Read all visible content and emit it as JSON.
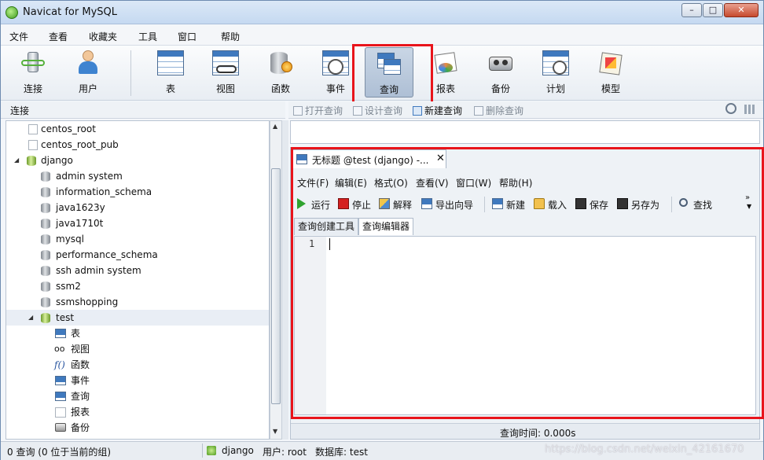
{
  "window": {
    "title": "Navicat for MySQL",
    "min": "–",
    "max": "□",
    "close": "✕"
  },
  "menu": [
    "文件",
    "查看",
    "收藏夹",
    "工具",
    "窗口",
    "帮助"
  ],
  "toolbar": [
    "连接",
    "用户",
    "表",
    "视图",
    "函数",
    "事件",
    "查询",
    "报表",
    "备份",
    "计划",
    "模型"
  ],
  "left": {
    "header": "连接",
    "tree": [
      {
        "label": "centos_root",
        "kind": "conn"
      },
      {
        "label": "centos_root_pub",
        "kind": "conn"
      },
      {
        "label": "django",
        "kind": "conn-open"
      },
      {
        "label": "admin system",
        "kind": "db"
      },
      {
        "label": "information_schema",
        "kind": "db"
      },
      {
        "label": "java1623y",
        "kind": "db"
      },
      {
        "label": "java1710t",
        "kind": "db"
      },
      {
        "label": "mysql",
        "kind": "db"
      },
      {
        "label": "performance_schema",
        "kind": "db"
      },
      {
        "label": "ssh admin system",
        "kind": "db"
      },
      {
        "label": "ssm2",
        "kind": "db"
      },
      {
        "label": "ssmshopping",
        "kind": "db"
      },
      {
        "label": "test",
        "kind": "db-open"
      },
      {
        "label": "表",
        "kind": "obj"
      },
      {
        "label": "视图",
        "kind": "obj"
      },
      {
        "label": "函数",
        "kind": "obj"
      },
      {
        "label": "事件",
        "kind": "obj"
      },
      {
        "label": "查询",
        "kind": "obj"
      },
      {
        "label": "报表",
        "kind": "obj"
      },
      {
        "label": "备份",
        "kind": "obj"
      }
    ]
  },
  "objectbar": {
    "open": "打开查询",
    "design": "设计查询",
    "new": "新建查询",
    "delete": "删除查询"
  },
  "query": {
    "tab_title": "无标题 @test (django) -...",
    "tab_close": "✕",
    "menu": [
      "文件(F)",
      "编辑(E)",
      "格式(O)",
      "查看(V)",
      "窗口(W)",
      "帮助(H)"
    ],
    "tools": [
      "运行",
      "停止",
      "解释",
      "导出向导",
      "新建",
      "载入",
      "保存",
      "另存为",
      "查找"
    ],
    "subtabs": [
      "查询创建工具",
      "查询编辑器"
    ],
    "line_number": "1",
    "status": "查询时间: 0.000s"
  },
  "statusbar": {
    "left": "0 查询 (0 位于当前的组)",
    "connection": "django",
    "user": "用户: root",
    "database": "数据库: test"
  },
  "watermark": "https://blog.csdn.net/weixin_42161670",
  "colors": {
    "highlight_box": "#e8141b",
    "accent": "#3f79be"
  }
}
